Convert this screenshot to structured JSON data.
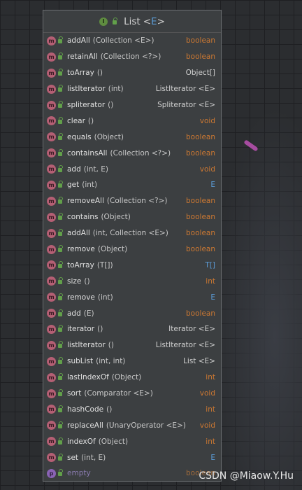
{
  "popup": {
    "class_icon_letter": "I",
    "title_name": "List",
    "title_lt": "<",
    "title_param": "E",
    "title_gt": ">"
  },
  "methods": [
    {
      "name": "addAll",
      "params": "(Collection <E>)",
      "returns": "boolean"
    },
    {
      "name": "retainAll",
      "params": "(Collection <?>)",
      "returns": "boolean"
    },
    {
      "name": "toArray",
      "params": "()",
      "returns": "Object[]"
    },
    {
      "name": "listIterator",
      "params": "(int)",
      "returns": "ListIterator <E>"
    },
    {
      "name": "spliterator",
      "params": "()",
      "returns": "Spliterator <E>"
    },
    {
      "name": "clear",
      "params": "()",
      "returns": "void"
    },
    {
      "name": "equals",
      "params": "(Object)",
      "returns": "boolean"
    },
    {
      "name": "containsAll",
      "params": "(Collection <?>)",
      "returns": "boolean"
    },
    {
      "name": "add",
      "params": "(int, E)",
      "returns": "void"
    },
    {
      "name": "get",
      "params": "(int)",
      "returns": "E"
    },
    {
      "name": "removeAll",
      "params": "(Collection <?>)",
      "returns": "boolean"
    },
    {
      "name": "contains",
      "params": "(Object)",
      "returns": "boolean"
    },
    {
      "name": "addAll",
      "params": "(int, Collection <E>)",
      "returns": "boolean"
    },
    {
      "name": "remove",
      "params": "(Object)",
      "returns": "boolean"
    },
    {
      "name": "toArray",
      "params": "(T[])",
      "returns": "T[]"
    },
    {
      "name": "size",
      "params": "()",
      "returns": "int"
    },
    {
      "name": "remove",
      "params": "(int)",
      "returns": "E"
    },
    {
      "name": "add",
      "params": "(E)",
      "returns": "boolean"
    },
    {
      "name": "iterator",
      "params": "()",
      "returns": "Iterator <E>"
    },
    {
      "name": "listIterator",
      "params": "()",
      "returns": "ListIterator <E>"
    },
    {
      "name": "subList",
      "params": "(int, int)",
      "returns": "List <E>"
    },
    {
      "name": "lastIndexOf",
      "params": "(Object)",
      "returns": "int"
    },
    {
      "name": "sort",
      "params": "(Comparator <E>)",
      "returns": "void"
    },
    {
      "name": "hashCode",
      "params": "()",
      "returns": "int"
    },
    {
      "name": "replaceAll",
      "params": "(UnaryOperator <E>)",
      "returns": "void"
    },
    {
      "name": "indexOf",
      "params": "(Object)",
      "returns": "int"
    },
    {
      "name": "set",
      "params": "(int, E)",
      "returns": "E"
    }
  ],
  "property": {
    "icon_letter": "p",
    "name": "empty",
    "returns": "boolean"
  },
  "method_icon_letter": "m",
  "watermark": "CSDN @Miaow.Y.Hu",
  "colors": {
    "background": "#2b2d30",
    "panel": "#3c3f41",
    "method_icon": "#b45f74",
    "property_icon": "#8a63b5",
    "lock": "#62a04a",
    "return_type": "#cc7832",
    "type_param": "#5b9bd5"
  }
}
